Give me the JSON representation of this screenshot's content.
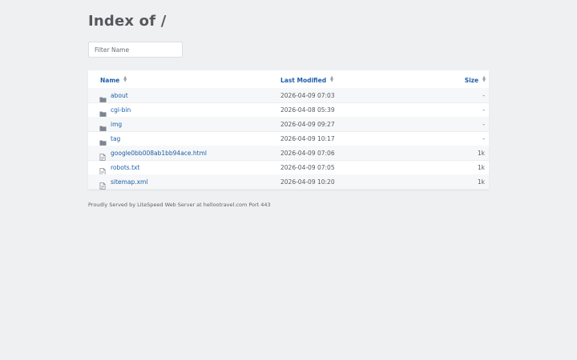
{
  "page": {
    "title": "Index of /",
    "filter_placeholder": "Filter Name",
    "footer": "Proudly Served by LiteSpeed Web Server at hellootravel.com Port 443"
  },
  "colors": {
    "background": "#eff0f2",
    "link": "#1d5fa7",
    "folder_icon": "#7d8590",
    "file_icon": "#8a9099"
  },
  "table": {
    "headers": {
      "name": "Name",
      "modified": "Last Modified",
      "size": "Size"
    },
    "rows": [
      {
        "type": "folder",
        "icon": "folder-icon",
        "name": "about",
        "modified": "2026-04-09 07:03",
        "size": "-"
      },
      {
        "type": "folder",
        "icon": "folder-icon",
        "name": "cgi-bin",
        "modified": "2026-04-08 05:39",
        "size": "-"
      },
      {
        "type": "folder",
        "icon": "folder-icon",
        "name": "img",
        "modified": "2026-04-09 09:27",
        "size": "-"
      },
      {
        "type": "folder",
        "icon": "folder-icon",
        "name": "tag",
        "modified": "2026-04-09 10:17",
        "size": "-"
      },
      {
        "type": "file",
        "icon": "file-icon",
        "name": "google0bb008ab1bb94ace.html",
        "modified": "2026-04-09 07:06",
        "size": "1k"
      },
      {
        "type": "file",
        "icon": "file-icon",
        "name": "robots.txt",
        "modified": "2026-04-09 07:05",
        "size": "1k"
      },
      {
        "type": "file",
        "icon": "file-icon",
        "name": "sitemap.xml",
        "modified": "2026-04-09 10:20",
        "size": "1k"
      }
    ]
  }
}
